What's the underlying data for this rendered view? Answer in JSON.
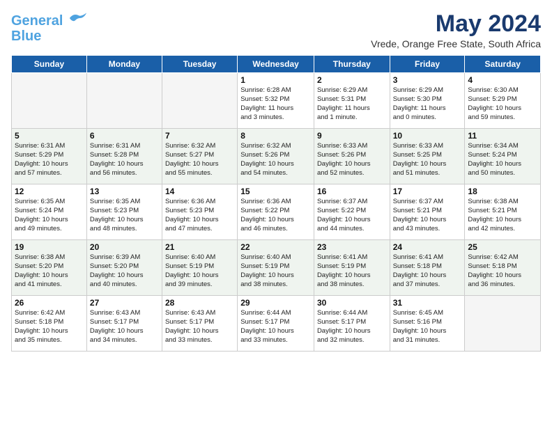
{
  "header": {
    "logo_line1": "General",
    "logo_line2": "Blue",
    "title": "May 2024",
    "subtitle": "Vrede, Orange Free State, South Africa"
  },
  "weekdays": [
    "Sunday",
    "Monday",
    "Tuesday",
    "Wednesday",
    "Thursday",
    "Friday",
    "Saturday"
  ],
  "weeks": [
    [
      {
        "day": "",
        "info": ""
      },
      {
        "day": "",
        "info": ""
      },
      {
        "day": "",
        "info": ""
      },
      {
        "day": "1",
        "info": "Sunrise: 6:28 AM\nSunset: 5:32 PM\nDaylight: 11 hours\nand 3 minutes."
      },
      {
        "day": "2",
        "info": "Sunrise: 6:29 AM\nSunset: 5:31 PM\nDaylight: 11 hours\nand 1 minute."
      },
      {
        "day": "3",
        "info": "Sunrise: 6:29 AM\nSunset: 5:30 PM\nDaylight: 11 hours\nand 0 minutes."
      },
      {
        "day": "4",
        "info": "Sunrise: 6:30 AM\nSunset: 5:29 PM\nDaylight: 10 hours\nand 59 minutes."
      }
    ],
    [
      {
        "day": "5",
        "info": "Sunrise: 6:31 AM\nSunset: 5:29 PM\nDaylight: 10 hours\nand 57 minutes."
      },
      {
        "day": "6",
        "info": "Sunrise: 6:31 AM\nSunset: 5:28 PM\nDaylight: 10 hours\nand 56 minutes."
      },
      {
        "day": "7",
        "info": "Sunrise: 6:32 AM\nSunset: 5:27 PM\nDaylight: 10 hours\nand 55 minutes."
      },
      {
        "day": "8",
        "info": "Sunrise: 6:32 AM\nSunset: 5:26 PM\nDaylight: 10 hours\nand 54 minutes."
      },
      {
        "day": "9",
        "info": "Sunrise: 6:33 AM\nSunset: 5:26 PM\nDaylight: 10 hours\nand 52 minutes."
      },
      {
        "day": "10",
        "info": "Sunrise: 6:33 AM\nSunset: 5:25 PM\nDaylight: 10 hours\nand 51 minutes."
      },
      {
        "day": "11",
        "info": "Sunrise: 6:34 AM\nSunset: 5:24 PM\nDaylight: 10 hours\nand 50 minutes."
      }
    ],
    [
      {
        "day": "12",
        "info": "Sunrise: 6:35 AM\nSunset: 5:24 PM\nDaylight: 10 hours\nand 49 minutes."
      },
      {
        "day": "13",
        "info": "Sunrise: 6:35 AM\nSunset: 5:23 PM\nDaylight: 10 hours\nand 48 minutes."
      },
      {
        "day": "14",
        "info": "Sunrise: 6:36 AM\nSunset: 5:23 PM\nDaylight: 10 hours\nand 47 minutes."
      },
      {
        "day": "15",
        "info": "Sunrise: 6:36 AM\nSunset: 5:22 PM\nDaylight: 10 hours\nand 46 minutes."
      },
      {
        "day": "16",
        "info": "Sunrise: 6:37 AM\nSunset: 5:22 PM\nDaylight: 10 hours\nand 44 minutes."
      },
      {
        "day": "17",
        "info": "Sunrise: 6:37 AM\nSunset: 5:21 PM\nDaylight: 10 hours\nand 43 minutes."
      },
      {
        "day": "18",
        "info": "Sunrise: 6:38 AM\nSunset: 5:21 PM\nDaylight: 10 hours\nand 42 minutes."
      }
    ],
    [
      {
        "day": "19",
        "info": "Sunrise: 6:38 AM\nSunset: 5:20 PM\nDaylight: 10 hours\nand 41 minutes."
      },
      {
        "day": "20",
        "info": "Sunrise: 6:39 AM\nSunset: 5:20 PM\nDaylight: 10 hours\nand 40 minutes."
      },
      {
        "day": "21",
        "info": "Sunrise: 6:40 AM\nSunset: 5:19 PM\nDaylight: 10 hours\nand 39 minutes."
      },
      {
        "day": "22",
        "info": "Sunrise: 6:40 AM\nSunset: 5:19 PM\nDaylight: 10 hours\nand 38 minutes."
      },
      {
        "day": "23",
        "info": "Sunrise: 6:41 AM\nSunset: 5:19 PM\nDaylight: 10 hours\nand 38 minutes."
      },
      {
        "day": "24",
        "info": "Sunrise: 6:41 AM\nSunset: 5:18 PM\nDaylight: 10 hours\nand 37 minutes."
      },
      {
        "day": "25",
        "info": "Sunrise: 6:42 AM\nSunset: 5:18 PM\nDaylight: 10 hours\nand 36 minutes."
      }
    ],
    [
      {
        "day": "26",
        "info": "Sunrise: 6:42 AM\nSunset: 5:18 PM\nDaylight: 10 hours\nand 35 minutes."
      },
      {
        "day": "27",
        "info": "Sunrise: 6:43 AM\nSunset: 5:17 PM\nDaylight: 10 hours\nand 34 minutes."
      },
      {
        "day": "28",
        "info": "Sunrise: 6:43 AM\nSunset: 5:17 PM\nDaylight: 10 hours\nand 33 minutes."
      },
      {
        "day": "29",
        "info": "Sunrise: 6:44 AM\nSunset: 5:17 PM\nDaylight: 10 hours\nand 33 minutes."
      },
      {
        "day": "30",
        "info": "Sunrise: 6:44 AM\nSunset: 5:17 PM\nDaylight: 10 hours\nand 32 minutes."
      },
      {
        "day": "31",
        "info": "Sunrise: 6:45 AM\nSunset: 5:16 PM\nDaylight: 10 hours\nand 31 minutes."
      },
      {
        "day": "",
        "info": ""
      }
    ]
  ]
}
